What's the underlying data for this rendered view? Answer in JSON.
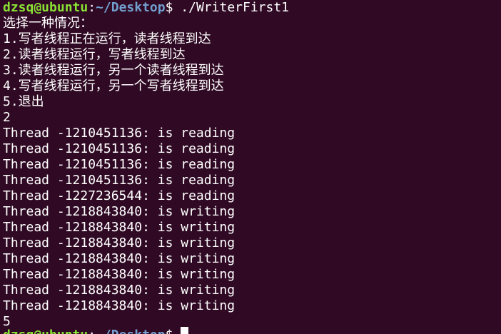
{
  "prompt": {
    "user_host": "dzsq@ubuntu",
    "separator": ":",
    "cwd": "~/Desktop",
    "symbol": "$ ",
    "command": "./WriterFirst1"
  },
  "output_lines": [
    "选择一种情况：",
    "1.写者线程正在运行，读者线程到达",
    "2.读者线程运行，写者线程到达",
    "3.读者线程运行，另一个读者线程到达",
    "4.写者线程运行，另一个写者线程到达",
    "5.退出",
    "2",
    "Thread -1210451136: is reading",
    "Thread -1210451136: is reading",
    "Thread -1210451136: is reading",
    "Thread -1210451136: is reading",
    "Thread -1227236544: is reading",
    "Thread -1218843840: is writing",
    "Thread -1218843840: is writing",
    "Thread -1218843840: is writing",
    "Thread -1218843840: is writing",
    "Thread -1218843840: is writing",
    "Thread -1218843840: is writing",
    "Thread -1218843840: is writing",
    "5"
  ],
  "colors": {
    "background": "#300a24",
    "text": "#ffffff",
    "user_host": "#8ae234",
    "cwd": "#729fcf"
  }
}
